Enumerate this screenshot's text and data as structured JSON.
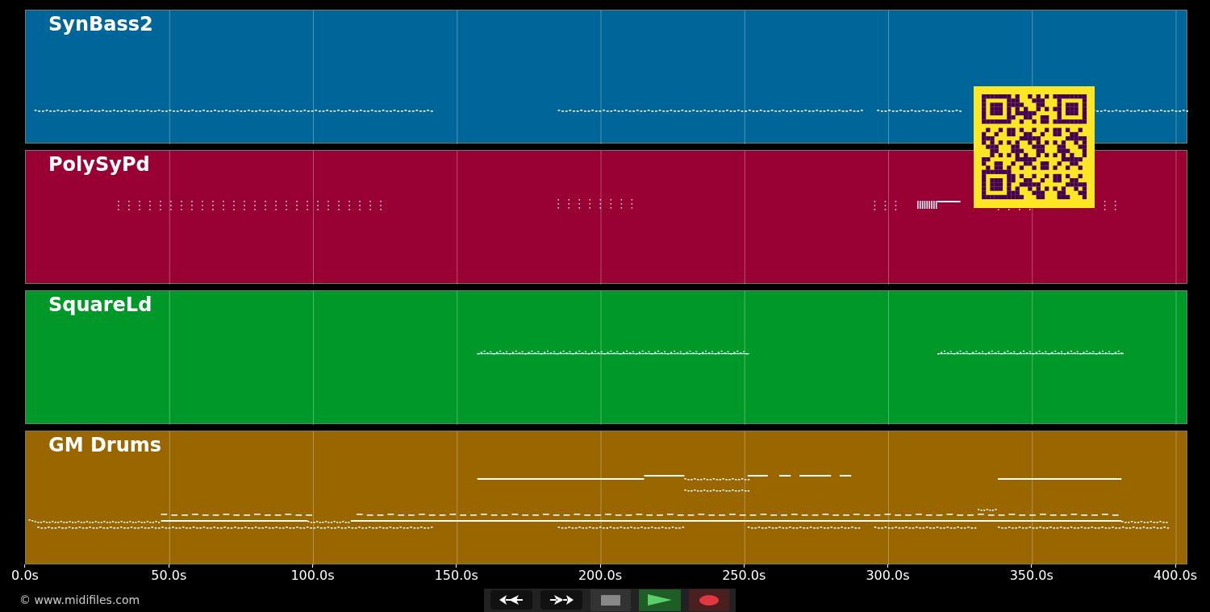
{
  "tracks": [
    {
      "name": "SynBass2",
      "color": "#006699"
    },
    {
      "name": "PolySyPd",
      "color": "#990033"
    },
    {
      "name": "SquareLd",
      "color": "#009929"
    },
    {
      "name": "GM Drums",
      "color": "#996600"
    }
  ],
  "axis": {
    "ticks": [
      "0.0s",
      "50.0s",
      "100.0s",
      "150.0s",
      "200.0s",
      "250.0s",
      "300.0s",
      "350.0s",
      "400.0s"
    ]
  },
  "transport": [
    {
      "kind": "rewind"
    },
    {
      "kind": "forward"
    },
    {
      "kind": "stop"
    },
    {
      "kind": "play"
    },
    {
      "kind": "record"
    }
  ],
  "copyright": "© www.midifiles.com"
}
